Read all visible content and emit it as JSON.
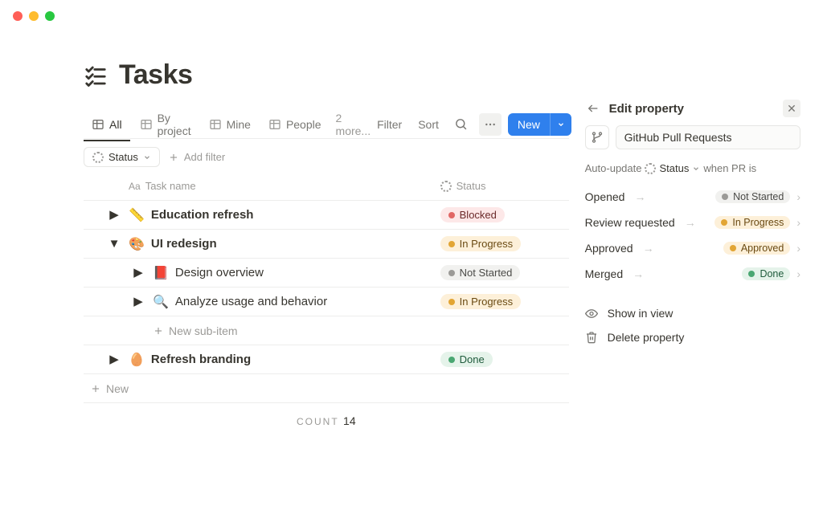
{
  "page": {
    "title": "Tasks"
  },
  "tabs": {
    "items": [
      {
        "label": "All",
        "active": true
      },
      {
        "label": "By project",
        "active": false
      },
      {
        "label": "Mine",
        "active": false
      },
      {
        "label": "People",
        "active": false
      }
    ],
    "more_label": "2 more..."
  },
  "toolbar": {
    "filter": "Filter",
    "sort": "Sort",
    "new_label": "New"
  },
  "filters": {
    "status_chip": "Status",
    "add_filter": "Add filter"
  },
  "columns": {
    "name": "Task name",
    "status": "Status"
  },
  "rows": [
    {
      "emoji": "📏",
      "name": "Education refresh",
      "status_label": "Blocked",
      "status_class": "pill-blocked",
      "expanded": false,
      "depth": 0
    },
    {
      "emoji": "🎨",
      "name": "UI redesign",
      "status_label": "In Progress",
      "status_class": "pill-inprogress",
      "expanded": true,
      "depth": 0
    },
    {
      "emoji": "📕",
      "name": "Design overview",
      "status_label": "Not Started",
      "status_class": "pill-notstarted",
      "expanded": false,
      "depth": 1
    },
    {
      "emoji": "🔍",
      "name": "Analyze usage and behavior",
      "status_label": "In Progress",
      "status_class": "pill-inprogress",
      "expanded": false,
      "depth": 1
    },
    {
      "emoji": "🥚",
      "name": "Refresh branding",
      "status_label": "Done",
      "status_class": "pill-done",
      "expanded": false,
      "depth": 0
    }
  ],
  "new_sub_item": "New sub-item",
  "new_item": "New",
  "count": {
    "label": "COUNT",
    "value": "14"
  },
  "panel": {
    "title": "Edit property",
    "input_value": "GitHub Pull Requests",
    "auto_update_prefix": "Auto-update",
    "auto_update_field": "Status",
    "auto_update_suffix": "when PR is",
    "mappings": [
      {
        "from": "Opened",
        "to_label": "Not Started",
        "to_class": "pill-notstarted"
      },
      {
        "from": "Review requested",
        "to_label": "In Progress",
        "to_class": "pill-inprogress"
      },
      {
        "from": "Approved",
        "to_label": "Approved",
        "to_class": "pill-approved"
      },
      {
        "from": "Merged",
        "to_label": "Done",
        "to_class": "pill-done"
      }
    ],
    "show_in_view": "Show in view",
    "delete_property": "Delete property"
  }
}
